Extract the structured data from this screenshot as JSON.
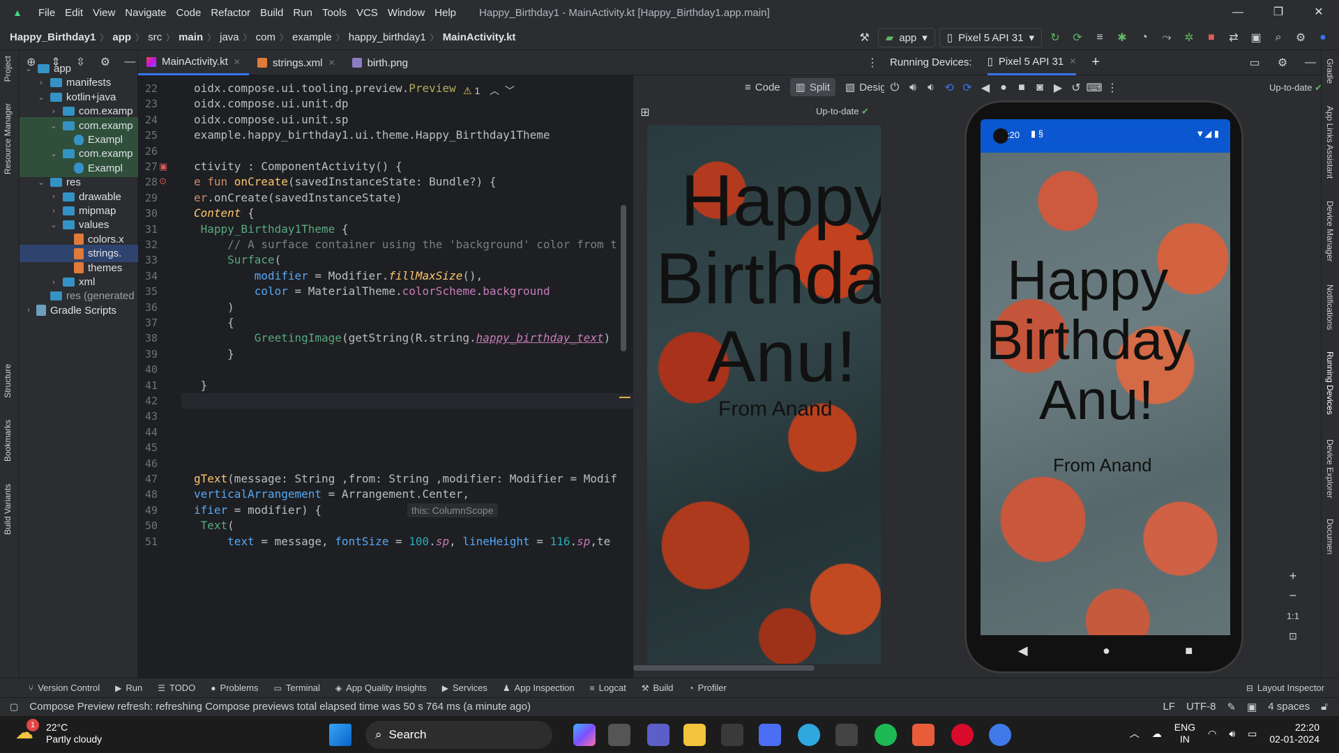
{
  "window": {
    "title": "Happy_Birthday1 - MainActivity.kt [Happy_Birthday1.app.main]",
    "menu": [
      "File",
      "Edit",
      "View",
      "Navigate",
      "Code",
      "Refactor",
      "Build",
      "Run",
      "Tools",
      "VCS",
      "Window",
      "Help"
    ]
  },
  "breadcrumbs": [
    "Happy_Birthday1",
    "app",
    "src",
    "main",
    "java",
    "com",
    "example",
    "happy_birthday1",
    "MainActivity.kt"
  ],
  "toolbar": {
    "run_config": "app",
    "device": "Pixel 5 API 31"
  },
  "project_tree": [
    {
      "label": "app",
      "depth": 0,
      "type": "folder",
      "expanded": true
    },
    {
      "label": "manifests",
      "depth": 1,
      "type": "folder",
      "expanded": false
    },
    {
      "label": "kotlin+java",
      "depth": 1,
      "type": "folder",
      "expanded": true
    },
    {
      "label": "com.examp",
      "depth": 2,
      "type": "package",
      "expanded": false
    },
    {
      "label": "com.examp",
      "depth": 2,
      "type": "package",
      "expanded": true
    },
    {
      "label": "Exampl",
      "depth": 3,
      "type": "class"
    },
    {
      "label": "com.examp",
      "depth": 2,
      "type": "package",
      "expanded": true
    },
    {
      "label": "Exampl",
      "depth": 3,
      "type": "class"
    },
    {
      "label": "res",
      "depth": 1,
      "type": "folder",
      "expanded": true
    },
    {
      "label": "drawable",
      "depth": 2,
      "type": "folder",
      "expanded": false
    },
    {
      "label": "mipmap",
      "depth": 2,
      "type": "folder",
      "expanded": false
    },
    {
      "label": "values",
      "depth": 2,
      "type": "folder",
      "expanded": true
    },
    {
      "label": "colors.x",
      "depth": 3,
      "type": "xml"
    },
    {
      "label": "strings.",
      "depth": 3,
      "type": "xml"
    },
    {
      "label": "themes",
      "depth": 3,
      "type": "xml"
    },
    {
      "label": "xml",
      "depth": 2,
      "type": "folder",
      "expanded": false
    },
    {
      "label": "res (generated",
      "depth": 1,
      "type": "folder"
    },
    {
      "label": "Gradle Scripts",
      "depth": 0,
      "type": "gradle",
      "expanded": false
    }
  ],
  "left_strip": [
    "Project",
    "Resource Manager",
    "Structure",
    "Bookmarks",
    "Build Variants"
  ],
  "right_strip": [
    "Gradle",
    "App Links Assistant",
    "Device Manager",
    "Notifications",
    "Running Devices",
    "Device Explorer",
    "Documen"
  ],
  "editor_tabs": [
    {
      "label": "MainActivity.kt",
      "icon": "kotlin-file-icon",
      "active": true
    },
    {
      "label": "strings.xml",
      "icon": "xml-file-icon",
      "active": false
    },
    {
      "label": "birth.png",
      "icon": "image-file-icon",
      "active": false
    }
  ],
  "view_modes": {
    "code": "Code",
    "split": "Split",
    "design": "Design",
    "active": "Split"
  },
  "editor": {
    "warnings": "1",
    "line_numbers": [
      "22",
      "23",
      "24",
      "25",
      "26",
      "27",
      "28",
      "29",
      "30",
      "31",
      "32",
      "33",
      "34",
      "35",
      "36",
      "37",
      "38",
      "39",
      "40",
      "41",
      "42",
      "43",
      "44",
      "45",
      "46",
      "47",
      "48",
      "49",
      "50",
      "51"
    ],
    "inlay_hint": "this: ColumnScope",
    "current_line": "42",
    "lines": [
      {
        "ln": "22",
        "tokens": [
          [
            "oidx.compose.ui.tooling.preview.",
            ""
          ],
          [
            "Preview",
            "ann"
          ]
        ]
      },
      {
        "ln": "23",
        "tokens": [
          [
            "oidx.compose.ui.unit.dp",
            ""
          ]
        ]
      },
      {
        "ln": "24",
        "tokens": [
          [
            "oidx.compose.ui.unit.sp",
            ""
          ]
        ]
      },
      {
        "ln": "25",
        "tokens": [
          [
            "example.happy_birthday1.ui.theme.Happy_Birthday1Theme",
            ""
          ]
        ]
      },
      {
        "ln": "26",
        "tokens": []
      },
      {
        "ln": "27",
        "tokens": [
          [
            "ctivity : ComponentActivity() {",
            ""
          ]
        ]
      },
      {
        "ln": "28",
        "tokens": [
          [
            "e fun ",
            "kw"
          ],
          [
            "onCreate",
            "fnc"
          ],
          [
            "(savedInstanceState: Bundle?) {",
            ""
          ]
        ]
      },
      {
        "ln": "29",
        "tokens": [
          [
            "er",
            "kw"
          ],
          [
            ".onCreate(savedInstanceState)",
            ""
          ]
        ]
      },
      {
        "ln": "30",
        "tokens": [
          [
            "Content",
            "fnc-it"
          ],
          [
            " {",
            ""
          ]
        ]
      },
      {
        "ln": "31",
        "tokens": [
          [
            " Happy_Birthday1Theme",
            "green-fn"
          ],
          [
            " {",
            ""
          ]
        ]
      },
      {
        "ln": "32",
        "tokens": [
          [
            "     // A surface container using the 'background' color from t",
            "cm"
          ]
        ]
      },
      {
        "ln": "33",
        "tokens": [
          [
            "     ",
            ""
          ],
          [
            "Surface",
            "green-fn"
          ],
          [
            "(",
            ""
          ]
        ]
      },
      {
        "ln": "34",
        "tokens": [
          [
            "         ",
            ""
          ],
          [
            "modifier",
            "param"
          ],
          [
            " = Modifier.",
            ""
          ],
          [
            "fillMaxSize",
            "fnc-it"
          ],
          [
            "(),",
            ""
          ]
        ]
      },
      {
        "ln": "35",
        "tokens": [
          [
            "         ",
            ""
          ],
          [
            "color",
            "param"
          ],
          [
            " = MaterialTheme.",
            ""
          ],
          [
            "colorScheme",
            "prop"
          ],
          [
            ".",
            ""
          ],
          [
            "background",
            "prop"
          ]
        ]
      },
      {
        "ln": "36",
        "tokens": [
          [
            "     )",
            ""
          ]
        ]
      },
      {
        "ln": "37",
        "tokens": [
          [
            "     {",
            ""
          ]
        ]
      },
      {
        "ln": "38",
        "tokens": [
          [
            "         ",
            ""
          ],
          [
            "GreetingImage",
            "green-fn"
          ],
          [
            "(getString(R.string.",
            ""
          ],
          [
            "happy_birthday_text",
            "it"
          ],
          [
            ")",
            ""
          ]
        ]
      },
      {
        "ln": "39",
        "tokens": [
          [
            "     }",
            ""
          ]
        ]
      },
      {
        "ln": "40",
        "tokens": []
      },
      {
        "ln": "41",
        "tokens": [
          [
            " }",
            ""
          ]
        ]
      },
      {
        "ln": "42",
        "tokens": []
      },
      {
        "ln": "43",
        "tokens": []
      },
      {
        "ln": "44",
        "tokens": []
      },
      {
        "ln": "45",
        "tokens": []
      },
      {
        "ln": "46",
        "tokens": []
      },
      {
        "ln": "47",
        "tokens": [
          [
            "gText",
            "fnc"
          ],
          [
            "(message: String ,from: String ,modifier: Modifier = Modif",
            ""
          ]
        ]
      },
      {
        "ln": "48",
        "tokens": [
          [
            "verticalArrangement",
            "param"
          ],
          [
            " = Arrangement.Center,",
            ""
          ]
        ]
      },
      {
        "ln": "49",
        "tokens": [
          [
            "ifier",
            "param"
          ],
          [
            " = modifier) { ",
            ""
          ]
        ]
      },
      {
        "ln": "50",
        "tokens": [
          [
            " ",
            ""
          ],
          [
            "Text",
            "green-fn"
          ],
          [
            "(",
            ""
          ]
        ]
      },
      {
        "ln": "51",
        "tokens": [
          [
            "     ",
            ""
          ],
          [
            "text",
            "param"
          ],
          [
            " = message, ",
            ""
          ],
          [
            "fontSize",
            "param"
          ],
          [
            " = ",
            ""
          ],
          [
            "100",
            "num"
          ],
          [
            ".",
            ""
          ],
          [
            "sp",
            "prop-it"
          ],
          [
            ", ",
            ""
          ],
          [
            "lineHeight",
            "param"
          ],
          [
            " = ",
            ""
          ],
          [
            "116",
            "num"
          ],
          [
            ".",
            ""
          ],
          [
            "sp",
            "prop-it"
          ],
          [
            ",te",
            ""
          ]
        ]
      }
    ]
  },
  "preview": {
    "status": "Up-to-date",
    "greeting_lines": [
      "Happy",
      "Birthda",
      "Anu!"
    ],
    "from": "From Anand"
  },
  "running_devices": {
    "title": "Running Devices:",
    "tab": "Pixel 5 API 31",
    "status": "Up-to-date",
    "phone_time": ":20",
    "greeting_lines": [
      "Happy",
      "Birthday",
      "Anu!"
    ],
    "from": "From Anand",
    "zoom_reset": "1:1"
  },
  "bottom_tools": [
    "Version Control",
    "Run",
    "TODO",
    "Problems",
    "Terminal",
    "App Quality Insights",
    "Services",
    "App Inspection",
    "Logcat",
    "Build",
    "Profiler"
  ],
  "bottom_right_tool": "Layout Inspector",
  "status_bar": {
    "message": "Compose Preview refresh: refreshing Compose previews total elapsed time was 50 s 764 ms (a minute ago)",
    "line_sep": "LF",
    "encoding": "UTF-8",
    "indent": "4 spaces"
  },
  "taskbar": {
    "weather_temp": "22°C",
    "weather_desc": "Partly cloudy",
    "weather_badge": "1",
    "search": "Search",
    "lang1": "ENG",
    "lang2": "IN",
    "time": "22:20",
    "date": "02-01-2024"
  },
  "colors": {
    "bg": "#2b2d30",
    "editor_bg": "#1e1f22",
    "accent": "#3574f0",
    "phone_statusbar": "#0b57d0"
  }
}
